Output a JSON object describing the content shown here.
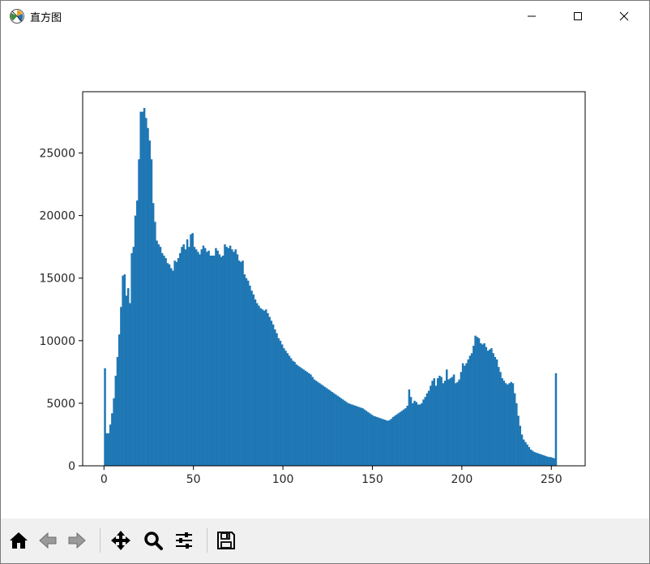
{
  "window": {
    "title": "直方图",
    "buttons": [
      "minimize",
      "maximize",
      "close"
    ]
  },
  "toolbar": {
    "buttons": [
      {
        "name": "home",
        "icon": "home-icon"
      },
      {
        "name": "back",
        "icon": "back-arrow-icon"
      },
      {
        "name": "forward",
        "icon": "forward-arrow-icon"
      },
      {
        "name": "pan",
        "icon": "move-icon"
      },
      {
        "name": "zoom",
        "icon": "magnifier-icon"
      },
      {
        "name": "configure-subplots",
        "icon": "sliders-icon"
      },
      {
        "name": "save",
        "icon": "floppy-disk-icon"
      }
    ]
  },
  "colors": {
    "bar": "#1f77b4",
    "toolbar": "#f0f0f0",
    "axis": "#000000"
  },
  "chart_data": {
    "type": "bar",
    "title": "",
    "xlabel": "",
    "ylabel": "",
    "xlim": [
      -11.9,
      268.9
    ],
    "ylim": [
      0,
      29900
    ],
    "xticks": [
      0,
      50,
      100,
      150,
      200,
      250
    ],
    "yticks": [
      0,
      5000,
      10000,
      15000,
      20000,
      25000
    ],
    "grid": false,
    "bin_width": 1,
    "x_start": 0,
    "values": [
      7800,
      2600,
      2600,
      3300,
      4200,
      5400,
      7200,
      8700,
      10500,
      12700,
      15200,
      15300,
      13600,
      14200,
      13000,
      17000,
      17500,
      20000,
      21200,
      24500,
      28300,
      28300,
      28600,
      27800,
      27000,
      26000,
      24500,
      21000,
      19500,
      18000,
      17700,
      17500,
      17000,
      16800,
      16600,
      16200,
      16100,
      15800,
      15600,
      16400,
      16300,
      16600,
      17000,
      17500,
      17700,
      17300,
      18100,
      17500,
      18500,
      18600,
      17500,
      17300,
      17100,
      16900,
      17300,
      17600,
      17400,
      17100,
      17200,
      16800,
      16800,
      16800,
      17400,
      17200,
      16900,
      16700,
      16800,
      17700,
      17500,
      17400,
      17600,
      17300,
      17100,
      17300,
      16900,
      16400,
      16300,
      16400,
      15300,
      15000,
      14800,
      14400,
      14000,
      13700,
      13300,
      13000,
      12800,
      12600,
      12500,
      12400,
      12500,
      12200,
      11900,
      11600,
      11300,
      10900,
      10600,
      10200,
      10000,
      9700,
      9400,
      9200,
      9000,
      8800,
      8600,
      8400,
      8300,
      8100,
      8000,
      7900,
      7800,
      7700,
      7600,
      7500,
      7400,
      7300,
      7100,
      6900,
      6800,
      6700,
      6600,
      6500,
      6400,
      6300,
      6200,
      6100,
      6000,
      5900,
      5800,
      5700,
      5600,
      5500,
      5400,
      5300,
      5200,
      5100,
      5000,
      4950,
      4900,
      4850,
      4800,
      4750,
      4700,
      4650,
      4600,
      4500,
      4400,
      4300,
      4200,
      4100,
      4000,
      3950,
      3900,
      3850,
      3800,
      3750,
      3700,
      3650,
      3600,
      3650,
      3750,
      3900,
      4000,
      4100,
      4200,
      4300,
      4400,
      4500,
      4600,
      4800,
      6100,
      5500,
      5000,
      5200,
      5100,
      4900,
      4900,
      5000,
      5300,
      5500,
      5800,
      6000,
      6400,
      6800,
      7000,
      6400,
      7000,
      7200,
      7100,
      6600,
      6800,
      7700,
      6900,
      7000,
      7100,
      7300,
      6600,
      6700,
      6900,
      7500,
      8200,
      8000,
      8200,
      8500,
      8800,
      9000,
      9600,
      10400,
      10300,
      10200,
      9800,
      9700,
      9800,
      9500,
      9200,
      9300,
      9400,
      9000,
      8700,
      8500,
      7900,
      7500,
      7000,
      6800,
      6600,
      6500,
      6600,
      6700,
      6600,
      5800,
      5000,
      4000,
      3200,
      2500,
      2100,
      1900,
      1700,
      1500,
      1300,
      1200,
      1100,
      1050,
      1000,
      950,
      900,
      850,
      800,
      750,
      700,
      700,
      650,
      600,
      7400
    ]
  }
}
